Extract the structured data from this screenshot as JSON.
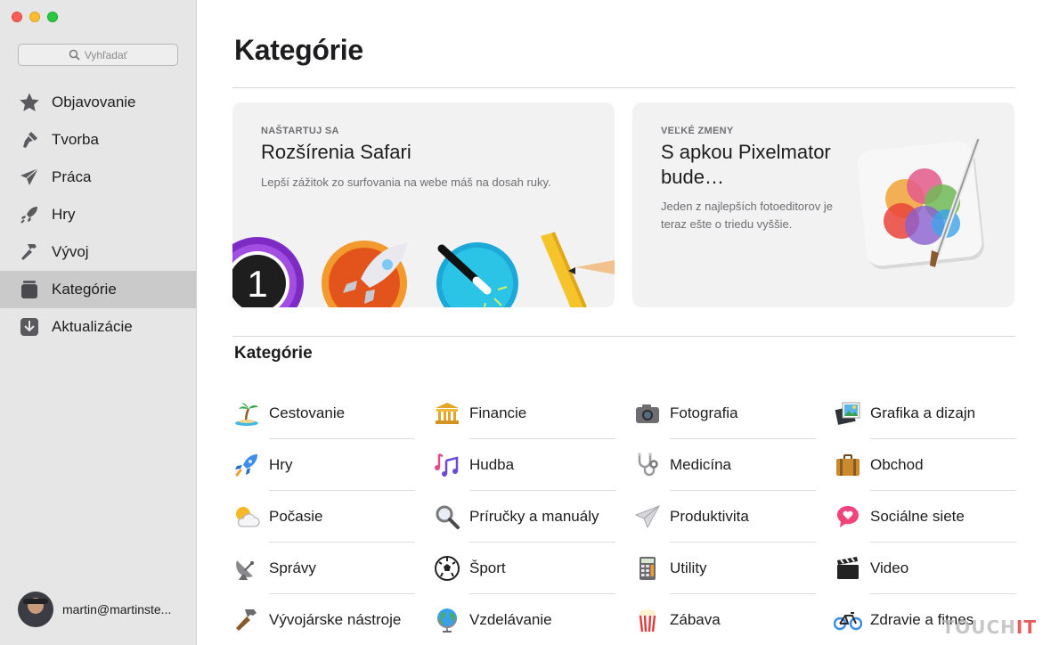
{
  "sidebar": {
    "search_placeholder": "Vyhľadať",
    "items": [
      {
        "label": "Objavovanie",
        "icon": "star-icon"
      },
      {
        "label": "Tvorba",
        "icon": "brush-icon"
      },
      {
        "label": "Práca",
        "icon": "paper-plane-icon"
      },
      {
        "label": "Hry",
        "icon": "rocket-icon"
      },
      {
        "label": "Vývoj",
        "icon": "hammer-icon"
      },
      {
        "label": "Kategórie",
        "icon": "stack-icon",
        "active": true
      },
      {
        "label": "Aktualizácie",
        "icon": "download-icon"
      }
    ],
    "user": "martin@martinste..."
  },
  "main": {
    "title": "Kategórie",
    "cards": [
      {
        "eyebrow": "NAŠTARTUJ SA",
        "title": "Rozšírenia Safari",
        "desc": "Lepší zážitok zo surfovania na webe máš na dosah ruky."
      },
      {
        "eyebrow": "VEĽKÉ ZMENY",
        "title": "S apkou Pixelmator bude…",
        "desc": "Jeden z najlepších fotoeditorov je teraz ešte o triedu vyššie."
      }
    ],
    "section_title": "Kategórie",
    "categories": [
      {
        "label": "Cestovanie",
        "icon": "palm-tree-icon"
      },
      {
        "label": "Financie",
        "icon": "bank-icon"
      },
      {
        "label": "Fotografia",
        "icon": "camera-icon"
      },
      {
        "label": "Grafika a dizajn",
        "icon": "picture-icon"
      },
      {
        "label": "Hry",
        "icon": "rocket-icon"
      },
      {
        "label": "Hudba",
        "icon": "music-notes-icon"
      },
      {
        "label": "Medicína",
        "icon": "stethoscope-icon"
      },
      {
        "label": "Obchod",
        "icon": "briefcase-icon"
      },
      {
        "label": "Počasie",
        "icon": "sun-cloud-icon"
      },
      {
        "label": "Príručky a manuály",
        "icon": "magnifier-icon"
      },
      {
        "label": "Produktivita",
        "icon": "paper-plane-icon"
      },
      {
        "label": "Sociálne siete",
        "icon": "chat-heart-icon"
      },
      {
        "label": "Správy",
        "icon": "satellite-dish-icon"
      },
      {
        "label": "Šport",
        "icon": "soccer-ball-icon"
      },
      {
        "label": "Utility",
        "icon": "calculator-icon"
      },
      {
        "label": "Video",
        "icon": "clapperboard-icon"
      },
      {
        "label": "Vývojárske nástroje",
        "icon": "hammer-icon"
      },
      {
        "label": "Vzdelávanie",
        "icon": "globe-icon"
      },
      {
        "label": "Zábava",
        "icon": "popcorn-icon"
      },
      {
        "label": "Zdravie a fitnes",
        "icon": "bicycle-icon"
      }
    ]
  },
  "watermark": {
    "part1": "TOUCH",
    "part2": "IT"
  }
}
